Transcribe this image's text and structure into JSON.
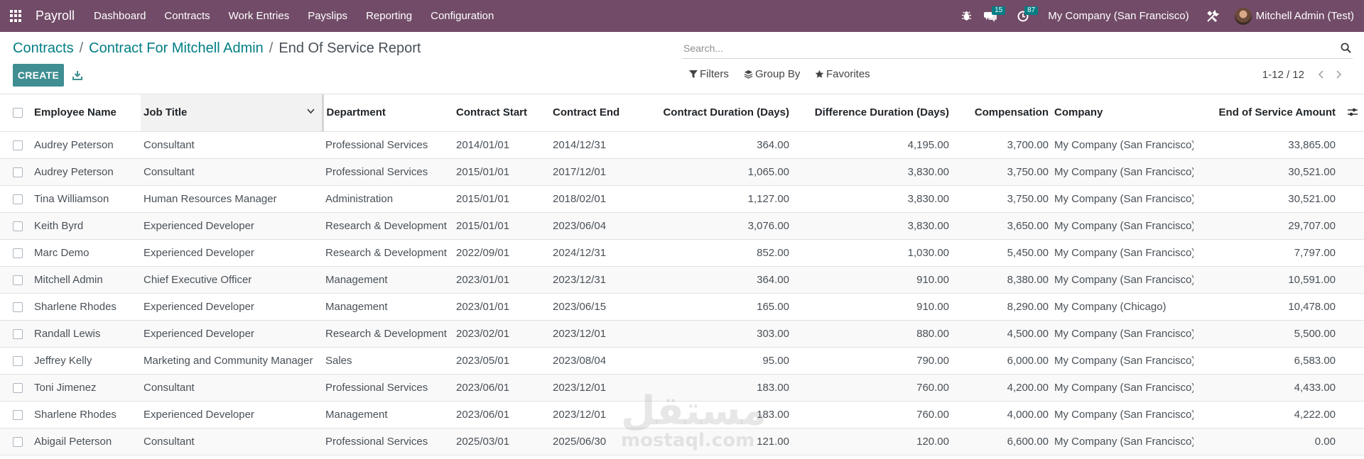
{
  "navbar": {
    "app_name": "Payroll",
    "menu": [
      "Dashboard",
      "Contracts",
      "Work Entries",
      "Payslips",
      "Reporting",
      "Configuration"
    ],
    "messages_count": "15",
    "activities_count": "87",
    "company": "My Company (San Francisco)",
    "user": "Mitchell Admin (Test)",
    "accent_color": "#714b67"
  },
  "breadcrumb": {
    "items": [
      "Contracts",
      "Contract For Mitchell Admin"
    ],
    "current": "End Of Service Report"
  },
  "actions": {
    "create_label": "CREATE"
  },
  "search": {
    "placeholder": "Search..."
  },
  "filters": {
    "filters_label": "Filters",
    "group_by_label": "Group By",
    "favorites_label": "Favorites"
  },
  "pager": {
    "value": "1-12 / 12"
  },
  "table": {
    "columns": [
      "Employee Name",
      "Job Title",
      "Department",
      "Contract Start",
      "Contract End",
      "Contract Duration (Days)",
      "Difference Duration (Days)",
      "Compensation",
      "Company",
      "End of Service Amount"
    ],
    "sorted_column": "Job Title",
    "rows": [
      [
        "Audrey Peterson",
        "Consultant",
        "Professional Services",
        "2014/01/01",
        "2014/12/31",
        "364.00",
        "4,195.00",
        "3,700.00",
        "My Company (San Francisco)",
        "33,865.00"
      ],
      [
        "Audrey Peterson",
        "Consultant",
        "Professional Services",
        "2015/01/01",
        "2017/12/01",
        "1,065.00",
        "3,830.00",
        "3,750.00",
        "My Company (San Francisco)",
        "30,521.00"
      ],
      [
        "Tina Williamson",
        "Human Resources Manager",
        "Administration",
        "2015/01/01",
        "2018/02/01",
        "1,127.00",
        "3,830.00",
        "3,750.00",
        "My Company (San Francisco)",
        "30,521.00"
      ],
      [
        "Keith Byrd",
        "Experienced Developer",
        "Research & Development",
        "2015/01/01",
        "2023/06/04",
        "3,076.00",
        "3,830.00",
        "3,650.00",
        "My Company (San Francisco)",
        "29,707.00"
      ],
      [
        "Marc Demo",
        "Experienced Developer",
        "Research & Development",
        "2022/09/01",
        "2024/12/31",
        "852.00",
        "1,030.00",
        "5,450.00",
        "My Company (San Francisco)",
        "7,797.00"
      ],
      [
        "Mitchell Admin",
        "Chief Executive Officer",
        "Management",
        "2023/01/01",
        "2023/12/31",
        "364.00",
        "910.00",
        "8,380.00",
        "My Company (San Francisco)",
        "10,591.00"
      ],
      [
        "Sharlene Rhodes",
        "Experienced Developer",
        "Management",
        "2023/01/01",
        "2023/06/15",
        "165.00",
        "910.00",
        "8,290.00",
        "My Company (Chicago)",
        "10,478.00"
      ],
      [
        "Randall Lewis",
        "Experienced Developer",
        "Research & Development",
        "2023/02/01",
        "2023/12/01",
        "303.00",
        "880.00",
        "4,500.00",
        "My Company (San Francisco)",
        "5,500.00"
      ],
      [
        "Jeffrey Kelly",
        "Marketing and Community Manager",
        "Sales",
        "2023/05/01",
        "2023/08/04",
        "95.00",
        "790.00",
        "6,000.00",
        "My Company (San Francisco)",
        "6,583.00"
      ],
      [
        "Toni Jimenez",
        "Consultant",
        "Professional Services",
        "2023/06/01",
        "2023/12/01",
        "183.00",
        "760.00",
        "4,200.00",
        "My Company (San Francisco)",
        "4,433.00"
      ],
      [
        "Sharlene Rhodes",
        "Experienced Developer",
        "Management",
        "2023/06/01",
        "2023/12/01",
        "183.00",
        "760.00",
        "4,000.00",
        "My Company (San Francisco)",
        "4,222.00"
      ],
      [
        "Abigail Peterson",
        "Consultant",
        "Professional Services",
        "2025/03/01",
        "2025/06/30",
        "121.00",
        "120.00",
        "6,600.00",
        "My Company (San Francisco)",
        "0.00"
      ]
    ]
  },
  "watermark": {
    "arabic": "مستقل",
    "latin": "mostaql.com"
  }
}
